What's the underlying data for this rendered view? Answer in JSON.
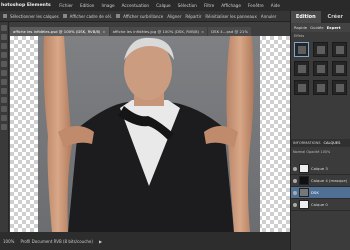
{
  "menubar": {
    "app_title": "hotoshop Elements",
    "items": [
      "Fichier",
      "Edition",
      "Image",
      "Accentuation",
      "Calque",
      "Sélection",
      "Filtre",
      "Affichage",
      "Fenêtre",
      "Aide"
    ]
  },
  "options_bar": {
    "items": [
      "Sélectionner les calques",
      "Afficher cadre de sél.",
      "Afficher surbrillance",
      "Aligner",
      "Répartir"
    ],
    "right_link": "Réinitialiser les panneaux",
    "annuler": "Annuler"
  },
  "document_tabs": [
    {
      "label": "affiche les infidèles.psd @ 100% (DSK, RVB/8)",
      "active": true
    },
    {
      "label": "affiche les infidèles.jpg @ 100% (DSK, RVB/8)",
      "active": false
    },
    {
      "label": "DSK 4…psd @ 21%",
      "active": false
    }
  ],
  "status_bar": {
    "zoom": "100%",
    "profile": "Profil Document RVB (8 bits/couche)",
    "arrow": "▶"
  },
  "panel": {
    "tabs": [
      "Edition",
      "Créer"
    ],
    "active_tab": "Edition",
    "subtabs": [
      "Rapide",
      "Guidée",
      "Expert"
    ],
    "style_label": "Effets",
    "effects_count": 12,
    "layers_head": [
      "INFORMATIONS",
      "CALQUES"
    ],
    "opts_text": "Normal   Opacité 100%",
    "layers": [
      {
        "name": "Calque 3",
        "thumb": "white",
        "selected": false
      },
      {
        "name": "Calque 4 (masque)",
        "thumb": "mask",
        "selected": false
      },
      {
        "name": "DSK",
        "thumb": "photo",
        "selected": true
      },
      {
        "name": "Calque 0",
        "thumb": "white",
        "selected": false
      }
    ]
  },
  "colors": {
    "menubar_bg": "#2a2a2a",
    "panel_bg": "#3b3b3b",
    "selected_layer": "#4f6f94",
    "canvas_bg": "#5b5b5b"
  }
}
